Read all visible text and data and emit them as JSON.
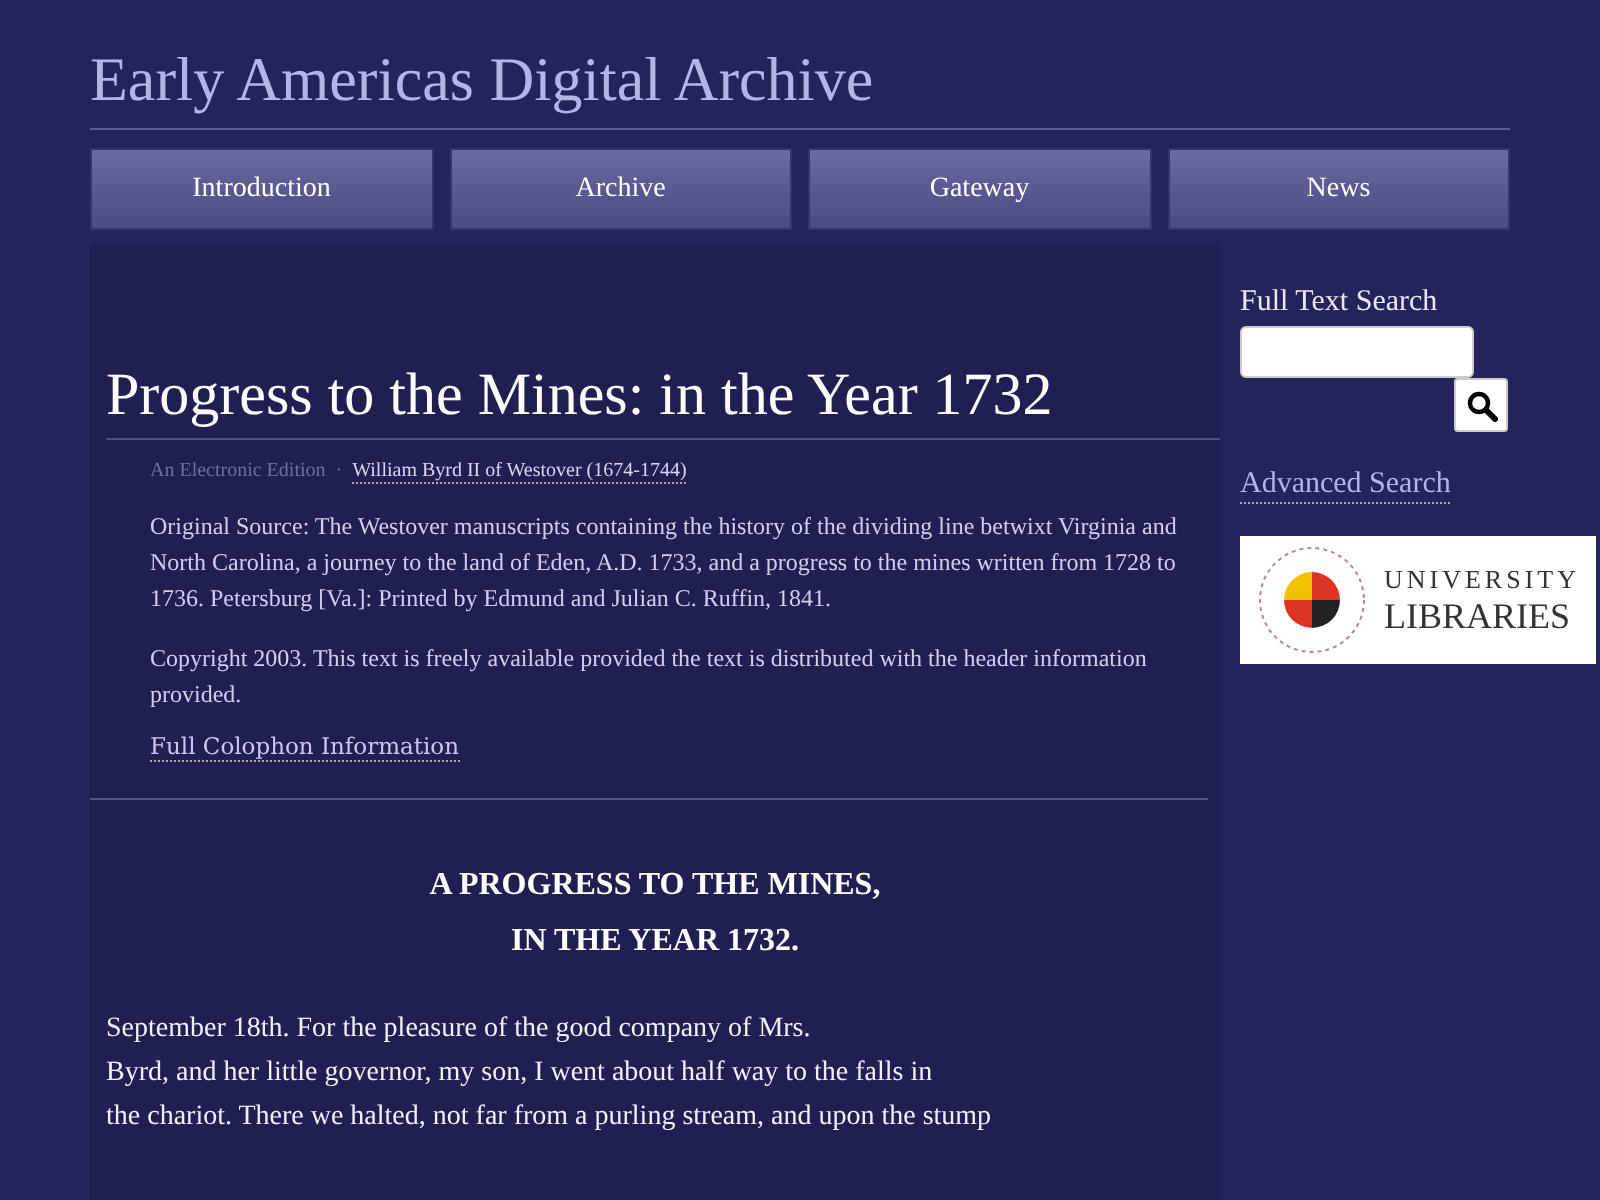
{
  "site_title": "Early Americas Digital Archive",
  "nav": [
    {
      "label": "Introduction"
    },
    {
      "label": "Archive"
    },
    {
      "label": "Gateway"
    },
    {
      "label": "News"
    }
  ],
  "document": {
    "title": "Progress to the Mines: in the Year 1732",
    "edition": "An Electronic Edition",
    "separator": "·",
    "author_link": "William Byrd II of Westover (1674-1744)",
    "source": "Original Source: The Westover manuscripts containing the history of the dividing line betwixt Virginia and North Carolina, a journey to the land of Eden, A.D. 1733, and a progress to the mines written from 1728 to 1736. Petersburg [Va.]: Printed by Edmund and Julian C. Ruffin, 1841.",
    "copyright": "Copyright 2003. This text is freely available provided the text is distributed with the header information provided.",
    "colophon_link": "Full Colophon Information"
  },
  "text": {
    "heading_lines": [
      "A PROGRESS TO THE MINES,",
      "IN THE YEAR 1732."
    ],
    "body_lines": [
      "September 18th. For the pleasure of the good company of Mrs.",
      "Byrd, and her little governor, my son, I went about half way to the falls in",
      "the chariot. There we halted, not far from a purling stream, and upon the stump"
    ]
  },
  "sidebar": {
    "search_label": "Full Text Search",
    "advanced_link": "Advanced Search",
    "logo_lines": [
      "UNIVERSITY",
      "LIBRARIES"
    ]
  }
}
